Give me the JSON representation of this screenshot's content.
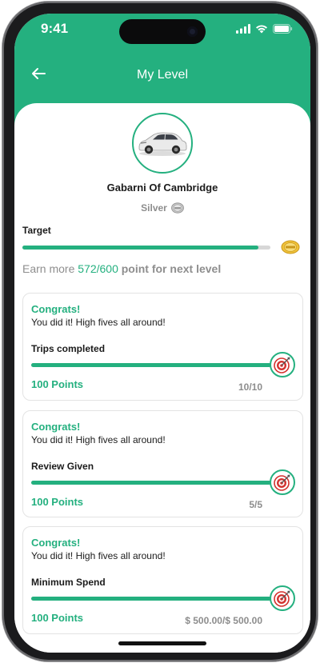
{
  "status_bar": {
    "time": "9:41"
  },
  "header": {
    "title": "My Level"
  },
  "profile": {
    "name": "Gabarni Of Cambridge",
    "level": "Silver"
  },
  "target": {
    "label": "Target",
    "progress_fraction": 0.953,
    "earn_prefix": "Earn more",
    "earn_value": "572/600",
    "earn_suffix": "point for next level"
  },
  "cards": [
    {
      "congrats": "Congrats!",
      "message": "You did it! High fives all around!",
      "task": "Trips completed",
      "points": "100 Points",
      "progress": "10/10",
      "progress_fraction": 1.0
    },
    {
      "congrats": "Congrats!",
      "message": "You did it! High fives all around!",
      "task": "Review Given",
      "points": "100 Points",
      "progress": "5/5",
      "progress_fraction": 1.0
    },
    {
      "congrats": "Congrats!",
      "message": "You did it! High fives all around!",
      "task": "Minimum Spend",
      "points": "100 Points",
      "progress": "$ 500.00/$ 500.00",
      "progress_fraction": 1.0
    }
  ],
  "colors": {
    "accent": "#24b07f",
    "muted": "#8d8d8d",
    "track": "#d7d7d7"
  }
}
